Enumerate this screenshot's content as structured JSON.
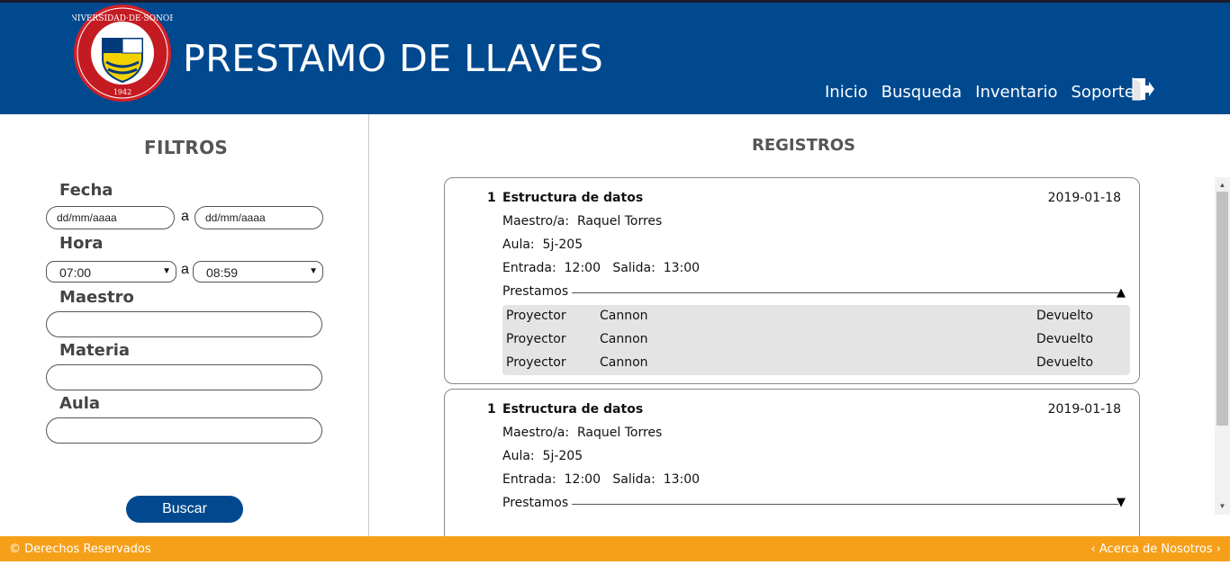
{
  "header": {
    "title": "PRESTAMO DE LLAVES",
    "logo_name": "universidad-de-sonora-seal",
    "nav": [
      "Inicio",
      "Busqueda",
      "Inventario",
      "Soporte"
    ],
    "logout_icon": "logout-icon",
    "colors": {
      "primary": "#00498f",
      "accent": "#f6a01a"
    }
  },
  "filters": {
    "title": "FILTROS",
    "fecha_label": "Fecha",
    "fecha_from_placeholder": "dd/mm/aaaa",
    "fecha_to_placeholder": "dd/mm/aaaa",
    "range_sep": "a",
    "hora_label": "Hora",
    "hora_from": "07:00",
    "hora_to": "08:59",
    "maestro_label": "Maestro",
    "materia_label": "Materia",
    "aula_label": "Aula",
    "search_button": "Buscar"
  },
  "registros": {
    "title": "REGISTROS",
    "cards": [
      {
        "num": "1",
        "course": "Estructura de datos",
        "date": "2019-01-18",
        "teacher_label": "Maestro/a:",
        "teacher": "Raquel Torres",
        "room_label": "Aula:",
        "room": "5j-205",
        "in_label": "Entrada:",
        "in_time": "12:00",
        "out_label": "Salida:",
        "out_time": "13:00",
        "loans_label": "Prestamos",
        "toggle": "▲",
        "loans": [
          {
            "item": "Proyector",
            "brand": "Cannon",
            "status": "Devuelto"
          },
          {
            "item": "Proyector",
            "brand": "Cannon",
            "status": "Devuelto"
          },
          {
            "item": "Proyector",
            "brand": "Cannon",
            "status": "Devuelto"
          }
        ]
      },
      {
        "num": "1",
        "course": "Estructura de datos",
        "date": "2019-01-18",
        "teacher_label": "Maestro/a:",
        "teacher": "Raquel Torres",
        "room_label": "Aula:",
        "room": "5j-205",
        "in_label": "Entrada:",
        "in_time": "12:00",
        "out_label": "Salida:",
        "out_time": "13:00",
        "loans_label": "Prestamos",
        "toggle": "▼"
      }
    ]
  },
  "footer": {
    "left": "© Derechos Reservados",
    "right": "‹ Acerca de Nosotros ›"
  }
}
